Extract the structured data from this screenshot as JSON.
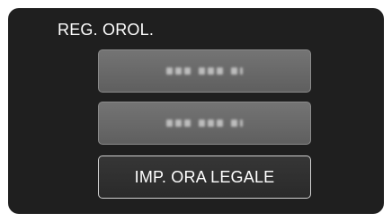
{
  "screen": {
    "title": "REG. OROL."
  },
  "menu": {
    "items": [
      {
        "label": "",
        "style": "blurred"
      },
      {
        "label": "",
        "style": "blurred"
      },
      {
        "label": "IMP. ORA LEGALE",
        "style": "plain"
      }
    ]
  },
  "colors": {
    "screen_bg": "#1f1f1f",
    "button_blurred_bg": "#6b6b6b",
    "button_plain_bg": "#303030",
    "text": "#ffffff"
  }
}
